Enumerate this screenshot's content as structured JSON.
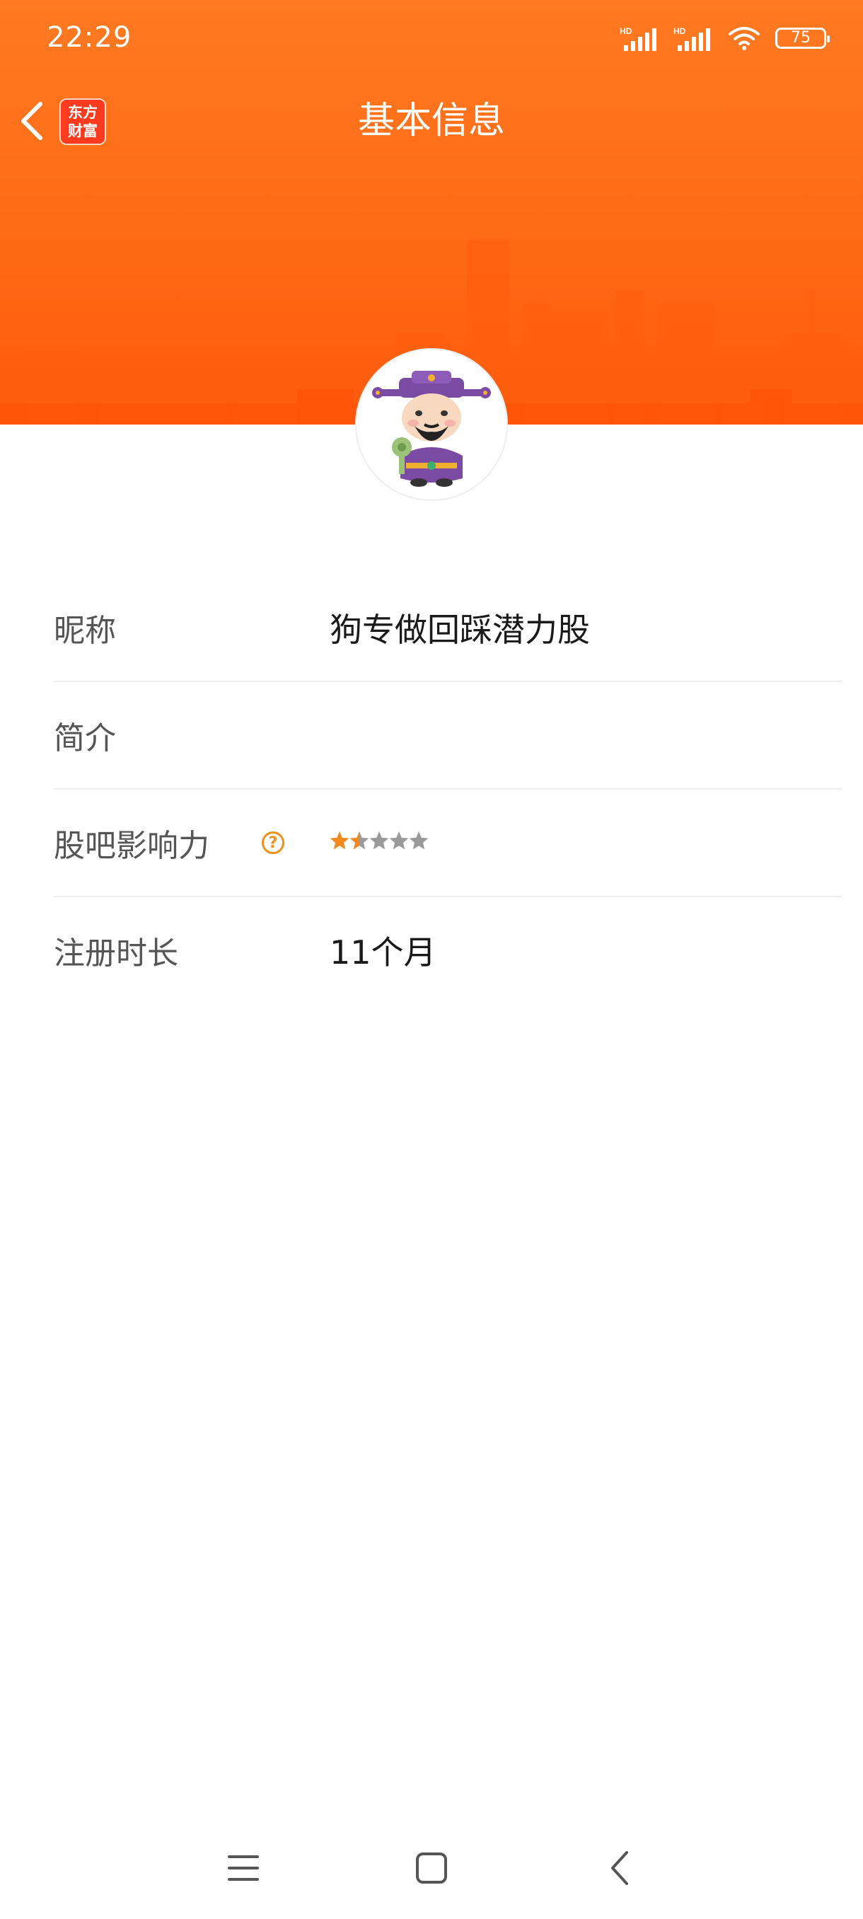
{
  "status_bar": {
    "time": "22:29",
    "battery": "75",
    "icons": [
      "hd-signal-icon",
      "hd-signal-icon",
      "wifi-icon",
      "battery-icon"
    ]
  },
  "header": {
    "title": "基本信息",
    "app_logo": [
      "东方",
      "财富"
    ],
    "back_icon": "chevron-left-icon",
    "accent_color": "#ff6a14"
  },
  "profile": {
    "nickname_label": "昵称",
    "nickname_value": "狗专做回踩潜力股",
    "bio_label": "简介",
    "bio_value": "",
    "influence_label": "股吧影响力",
    "influence_help_icon": "?",
    "influence_rating": 1.5,
    "influence_max": 5,
    "register_label": "注册时长",
    "register_value": "11个月"
  },
  "colors": {
    "star_filled": "#f08a1e",
    "star_empty": "#9a9a9a"
  },
  "system_nav": {
    "icons": [
      "menu-icon",
      "home-icon",
      "back-icon"
    ]
  }
}
